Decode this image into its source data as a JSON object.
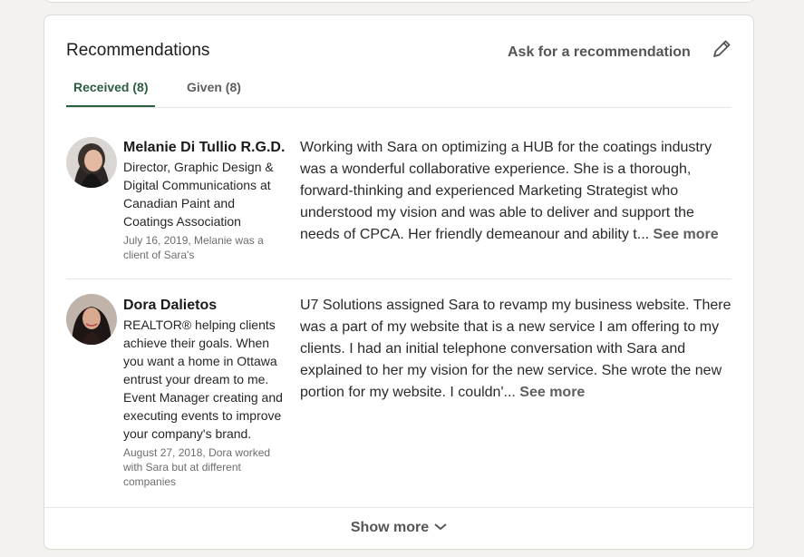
{
  "section": {
    "title": "Recommendations",
    "ask_label": "Ask for a recommendation",
    "edit_icon": "pencil-icon"
  },
  "tabs": [
    {
      "label": "Received (8)",
      "active": true
    },
    {
      "label": "Given (8)",
      "active": false
    }
  ],
  "recommendations": [
    {
      "name": "Melanie Di Tullio R.G.D.",
      "headline": "Director, Graphic Design & Digital Communications at Canadian Paint and Coatings Association",
      "date": "July 16, 2019, Melanie was a client of Sara's",
      "text": "Working with Sara on optimizing a HUB for the coatings industry was a wonderful collaborative experience. She is a thorough, forward-thinking and experienced Marketing Strategist who understood my vision and was able to deliver and support the needs of CPCA. Her friendly demeanour and ability t...",
      "see_more": "See more"
    },
    {
      "name": "Dora Dalietos",
      "headline": "REALTOR® helping clients achieve their goals. When you want a home in Ottawa entrust your dream to me. Event Manager creating and executing events to improve your company's brand.",
      "date": "August 27, 2018, Dora worked with Sara but at different companies",
      "text": "U7 Solutions assigned Sara to revamp my business website. There was a part of my website that is a new service I am offering to my clients. I had an initial telephone conversation with Sara and explained to her my vision for the new service. She wrote the new portion for my website. I couldn'...",
      "see_more": "See more"
    }
  ],
  "footer": {
    "show_more_label": "Show more",
    "icon": "chevron-down-icon"
  },
  "colors": {
    "accent_green": "#2d5d3f",
    "page_bg": "#f3f2ef"
  }
}
